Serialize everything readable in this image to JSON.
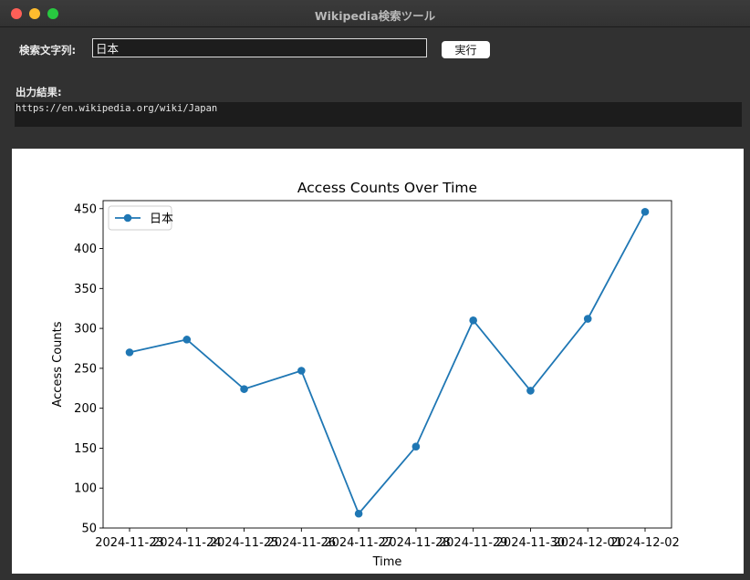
{
  "window": {
    "title": "Wikipedia検索ツール"
  },
  "search": {
    "label": "検索文字列:",
    "value": "日本",
    "button_label": "実行"
  },
  "output": {
    "label": "出力結果:",
    "text": "https://en.wikipedia.org/wiki/Japan"
  },
  "colors": {
    "line": "#1f77b4"
  },
  "chart_data": {
    "type": "line",
    "title": "Access Counts Over Time",
    "xlabel": "Time",
    "ylabel": "Access Counts",
    "x": [
      "2024-11-23",
      "2024-11-24",
      "2024-11-25",
      "2024-11-26",
      "2024-11-27",
      "2024-11-28",
      "2024-11-29",
      "2024-11-30",
      "2024-12-01",
      "2024-12-02"
    ],
    "x_tick_labels": [
      "2024-11-23",
      "2024-11-24",
      "2024-11-25",
      "2024-11-26",
      "2024-11-27",
      "2024-11-28",
      "2024-11-29",
      "2024-11-30",
      "2024-12-01",
      "2024-12-02"
    ],
    "series": [
      {
        "name": "日本",
        "values": [
          270,
          286,
          224,
          247,
          68,
          152,
          310,
          222,
          312,
          446
        ]
      }
    ],
    "ylim": [
      50,
      460
    ],
    "yticks": [
      50,
      100,
      150,
      200,
      250,
      300,
      350,
      400,
      450
    ],
    "grid": false,
    "legend": "top-left"
  }
}
